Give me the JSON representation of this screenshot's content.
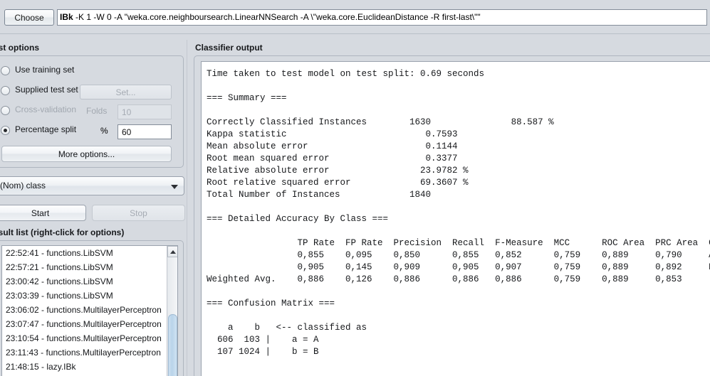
{
  "chooser": {
    "choose_label": "Choose",
    "classifier_name": "IBk",
    "classifier_options": " -K 1 -W 0 -A \"weka.core.neighboursearch.LinearNNSearch -A \\\"weka.core.EuclideanDistance -R first-last\\\"\""
  },
  "test_options": {
    "title": "est options",
    "items": [
      {
        "label": "Use training set",
        "selected": false
      },
      {
        "label": "Supplied test set",
        "selected": false
      },
      {
        "label": "Cross-validation",
        "selected": false
      },
      {
        "label": "Percentage split",
        "selected": true
      }
    ],
    "set_button_label": "Set...",
    "folds_label": "Folds",
    "folds_value": "10",
    "percent_label": "%",
    "percent_value": "60",
    "more_options_label": "More options..."
  },
  "class_attribute": {
    "selected": "(Nom) class"
  },
  "run_buttons": {
    "start_label": "Start",
    "stop_label": "Stop"
  },
  "result_list": {
    "title": "esult list (right-click for options)",
    "items": [
      "22:52:41 - functions.LibSVM",
      "22:57:21 - functions.LibSVM",
      "23:00:42 - functions.LibSVM",
      "23:03:39 - functions.LibSVM",
      "23:06:02 - functions.MultilayerPerceptron",
      "23:07:47 - functions.MultilayerPerceptron",
      "23:10:54 - functions.MultilayerPerceptron",
      "23:11:43 - functions.MultilayerPerceptron",
      "21:48:15 - lazy.IBk"
    ]
  },
  "classifier_output": {
    "title": "Classifier output",
    "time_taken_line": "Time taken to test model on test split: 0.69 seconds",
    "summary_heading": "=== Summary ===",
    "summary": [
      {
        "label": "Correctly Classified Instances",
        "value": "1630",
        "extra": "88.587",
        "unit": "%"
      },
      {
        "label": "Kappa statistic",
        "value": "0.7593",
        "extra": "",
        "unit": ""
      },
      {
        "label": "Mean absolute error",
        "value": "0.1144",
        "extra": "",
        "unit": ""
      },
      {
        "label": "Root mean squared error",
        "value": "0.3377",
        "extra": "",
        "unit": ""
      },
      {
        "label": "Relative absolute error",
        "value": "23.9782",
        "extra": "",
        "unit": "%"
      },
      {
        "label": "Root relative squared error",
        "value": "69.3607",
        "extra": "",
        "unit": "%"
      },
      {
        "label": "Total Number of Instances",
        "value": "1840",
        "extra": "",
        "unit": ""
      }
    ],
    "detailed_heading": "=== Detailed Accuracy By Class ===",
    "detailed_columns": [
      "TP Rate",
      "FP Rate",
      "Precision",
      "Recall",
      "F-Measure",
      "MCC",
      "ROC Area",
      "PRC Area",
      "Class"
    ],
    "detailed_rows": [
      {
        "row_label": "",
        "values": [
          "0,855",
          "0,095",
          "0,850",
          "0,855",
          "0,852",
          "0,759",
          "0,889",
          "0,790"
        ],
        "class": "A"
      },
      {
        "row_label": "",
        "values": [
          "0,905",
          "0,145",
          "0,909",
          "0,905",
          "0,907",
          "0,759",
          "0,889",
          "0,892"
        ],
        "class": "B"
      },
      {
        "row_label": "Weighted Avg.",
        "values": [
          "0,886",
          "0,126",
          "0,886",
          "0,886",
          "0,886",
          "0,759",
          "0,889",
          "0,853"
        ],
        "class": ""
      }
    ],
    "confusion_heading": "=== Confusion Matrix ===",
    "confusion_col_labels": [
      "a",
      "b"
    ],
    "confusion_classified_as": "<-- classified as",
    "confusion_rows": [
      {
        "counts": [
          "606",
          "103"
        ],
        "label": "a = A"
      },
      {
        "counts": [
          "107",
          "1024"
        ],
        "label": "b = B"
      }
    ],
    "full_text": "Time taken to test model on test split: 0.69 seconds\n\n=== Summary ===\n\nCorrectly Classified Instances        1630               88.587 %\nKappa statistic                          0.7593\nMean absolute error                      0.1144\nRoot mean squared error                  0.3377\nRelative absolute error                 23.9782 %\nRoot relative squared error             69.3607 %\nTotal Number of Instances             1840\n\n=== Detailed Accuracy By Class ===\n\n                 TP Rate  FP Rate  Precision  Recall  F-Measure  MCC      ROC Area  PRC Area  Class\n                 0,855    0,095    0,850      0,855   0,852      0,759    0,889     0,790     A\n                 0,905    0,145    0,909      0,905   0,907      0,759    0,889     0,892     B\nWeighted Avg.    0,886    0,126    0,886      0,886   0,886      0,759    0,889     0,853\n\n=== Confusion Matrix ===\n\n    a    b   <-- classified as\n  606  103 |    a = A\n  107 1024 |    b = B"
  }
}
